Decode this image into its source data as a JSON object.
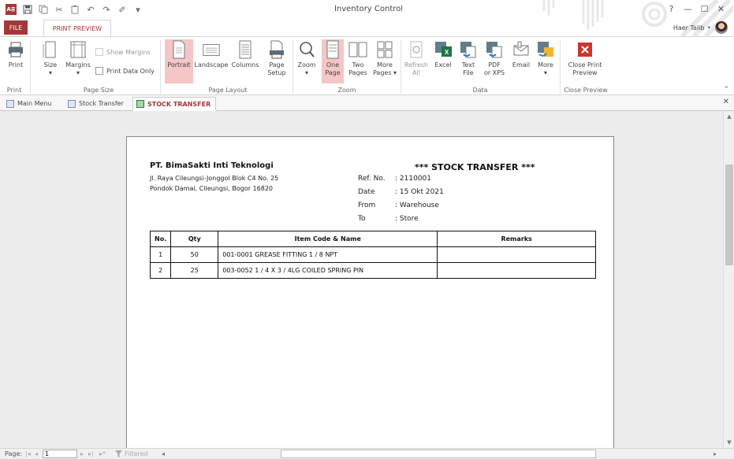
{
  "window": {
    "title": "Inventory Control",
    "logo_text": "A≣",
    "help_icon": "?",
    "minimize_icon": "—",
    "restore_icon": "☐",
    "close_icon": "✕"
  },
  "tabs": {
    "file": "FILE",
    "print_preview": "PRINT PREVIEW"
  },
  "user": {
    "name": "Haer Talib",
    "chevron": "▾"
  },
  "ribbon": {
    "print_group": {
      "label": "Print",
      "print": "Print"
    },
    "page_size_group": {
      "label": "Page Size",
      "size": "Size",
      "margins": "Margins",
      "show_margins": "Show Margins",
      "print_data_only": "Print Data Only"
    },
    "page_layout_group": {
      "label": "Page Layout",
      "portrait": "Portrait",
      "landscape": "Landscape",
      "columns": "Columns",
      "page_setup_1": "Page",
      "page_setup_2": "Setup"
    },
    "zoom_group": {
      "label": "Zoom",
      "zoom": "Zoom",
      "one_page_1": "One",
      "one_page_2": "Page",
      "two_pages_1": "Two",
      "two_pages_2": "Pages",
      "more_pages_1": "More",
      "more_pages_2": "Pages ▾"
    },
    "data_group": {
      "label": "Data",
      "refresh_1": "Refresh",
      "refresh_2": "All",
      "excel": "Excel",
      "text_file_1": "Text",
      "text_file_2": "File",
      "pdf_1": "PDF",
      "pdf_2": "or XPS",
      "email": "Email",
      "more": "More"
    },
    "close_group": {
      "label": "Close Preview",
      "close_1": "Close Print",
      "close_2": "Preview"
    }
  },
  "object_tabs": [
    "Main Menu",
    "Stock Transfer",
    "STOCK TRANSFER"
  ],
  "report": {
    "company": "PT. BimaSakti Inti Teknologi",
    "address_line1": "Jl. Raya Cileungsi-Jonggol Blok C4 No. 25",
    "address_line2": "Pondok Damai, Cileungsi, Bogor 16820",
    "title": "*** STOCK TRANSFER ***",
    "meta": [
      {
        "label": "Ref. No.",
        "value": ": 2110001"
      },
      {
        "label": "Date",
        "value": ": 15 Okt 2021"
      },
      {
        "label": "From",
        "value": ": Warehouse"
      },
      {
        "label": "To",
        "value": ": Store"
      }
    ],
    "columns": [
      "No.",
      "Qty",
      "Item Code & Name",
      "Remarks"
    ],
    "rows": [
      {
        "no": "1",
        "qty": "50",
        "item": "001-0001   GREASE FITTING 1 / 8 NPT",
        "remarks": ""
      },
      {
        "no": "2",
        "qty": "25",
        "item": "003-0052   1 / 4 X 3 / 4LG COILED SPRING PIN",
        "remarks": ""
      }
    ]
  },
  "status": {
    "page_label": "Page:",
    "page_value": "1",
    "filter_label": "Filtered",
    "nav_first": "|◂",
    "nav_prev": "◂",
    "nav_next": "▸",
    "nav_last": "▸|",
    "nav_new": "▸*"
  }
}
